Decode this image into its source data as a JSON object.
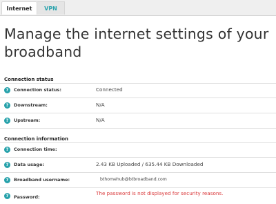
{
  "tabs": [
    {
      "label": "Internet"
    },
    {
      "label": "VPN"
    }
  ],
  "page": {
    "headline": "Manage the internet settings of your broadband"
  },
  "connection_status": {
    "title": "Connection status",
    "rows": [
      {
        "label": "Connection status:",
        "value": "Connected"
      },
      {
        "label": "Downstream:",
        "value": "N/A"
      },
      {
        "label": "Upstream:",
        "value": "N/A"
      }
    ]
  },
  "connection_information": {
    "title": "Connection information",
    "rows": [
      {
        "label": "Connection time:",
        "value": ""
      },
      {
        "label": "Data usage:",
        "value": "2.43 KB Uploaded / 635.44 KB Downloaded"
      },
      {
        "label": "Broadband username:",
        "value": "bthomehub@btbroadband.com"
      },
      {
        "label": "Password:",
        "value": "The password is not displayed for security reasons."
      }
    ]
  },
  "help_icon_glyph": "?",
  "colors": {
    "accent": "#27a2ab",
    "warning": "#d9383a"
  }
}
